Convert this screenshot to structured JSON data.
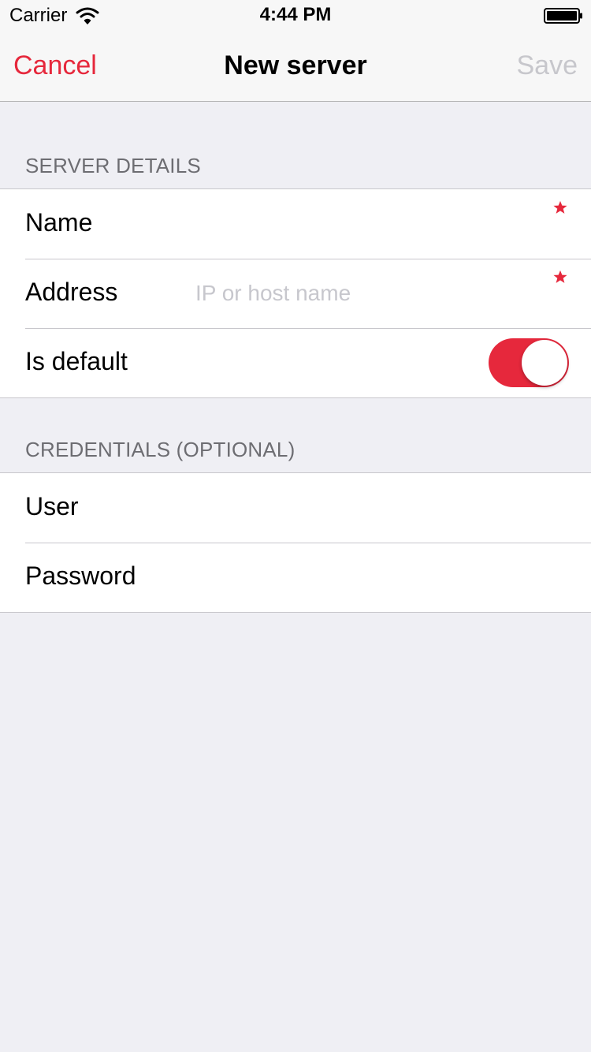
{
  "status_bar": {
    "carrier": "Carrier",
    "time": "4:44 PM",
    "icons": [
      "wifi-icon",
      "battery-icon"
    ]
  },
  "navbar": {
    "cancel_label": "Cancel",
    "title": "New server",
    "save_label": "Save"
  },
  "server_details": {
    "header": "SERVER DETAILS",
    "name": {
      "label": "Name",
      "value": "",
      "placeholder": "",
      "required": true
    },
    "address": {
      "label": "Address",
      "value": "",
      "placeholder": "IP or host name",
      "required": true
    },
    "is_default": {
      "label": "Is default",
      "on": true
    }
  },
  "credentials": {
    "header": "CREDENTIALS (OPTIONAL)",
    "user": {
      "label": "User",
      "value": "",
      "placeholder": ""
    },
    "password": {
      "label": "Password",
      "value": "",
      "placeholder": ""
    }
  },
  "colors": {
    "accent": "#e6283c",
    "disabled": "#c7c7cc",
    "background": "#efeff4",
    "section_header": "#6d6d72",
    "separator": "#c8c7cc"
  }
}
